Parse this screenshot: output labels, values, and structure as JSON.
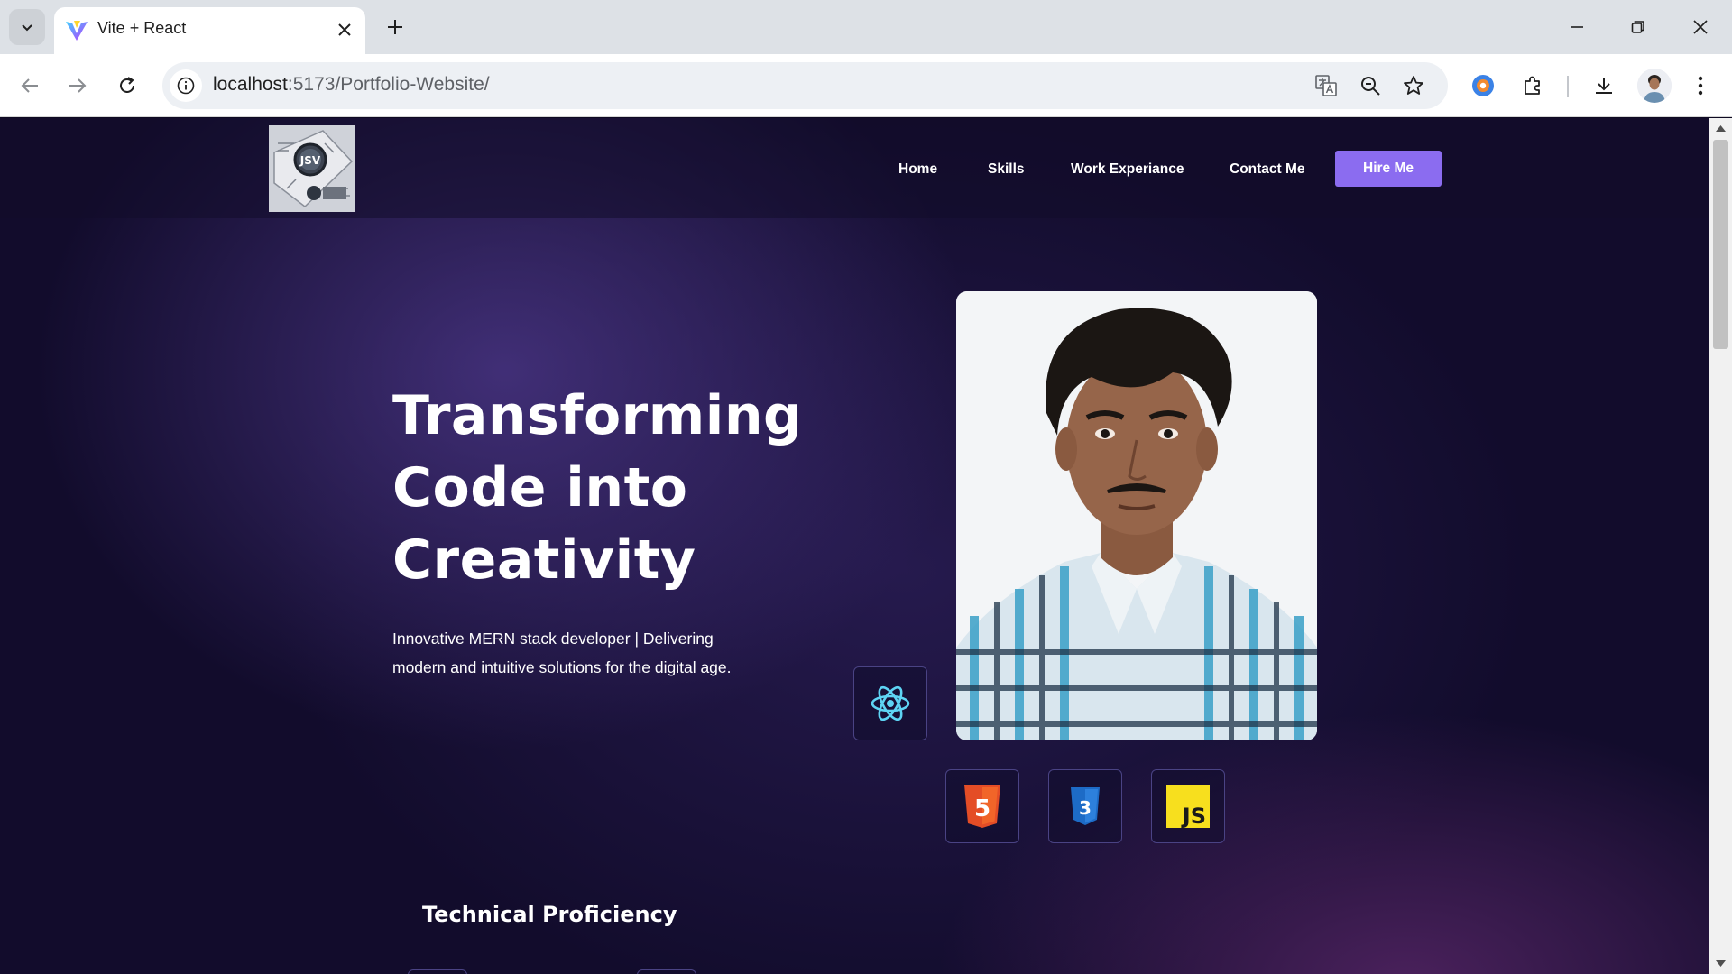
{
  "browser": {
    "tab_title": "Vite + React",
    "url_host": "localhost",
    "url_path": ":5173/Portfolio-Website/"
  },
  "site": {
    "logo_text": "JSV",
    "nav": [
      "Home",
      "Skills",
      "Work Experiance",
      "Contact Me"
    ],
    "hire_label": "Hire Me"
  },
  "hero": {
    "title_lines": [
      "Transforming",
      "Code into",
      "Creativity"
    ],
    "subtitle_lines": [
      "Innovative MERN stack developer | Delivering",
      "modern and intuitive solutions for the digital age."
    ]
  },
  "tech_icons": {
    "react": "react-icon",
    "html": "html5-icon",
    "css": "css3-icon",
    "js": "javascript-icon",
    "js_label": "JS",
    "html_label": "5",
    "css_label": "3"
  },
  "colors": {
    "accent": "#8b6cf0",
    "background": "#120c2c",
    "react": "#5ed4f4",
    "html": "#e44d26",
    "css": "#1d6bc6",
    "js": "#f7df1e"
  },
  "sections": {
    "next_title": "Technical Proficiency"
  }
}
